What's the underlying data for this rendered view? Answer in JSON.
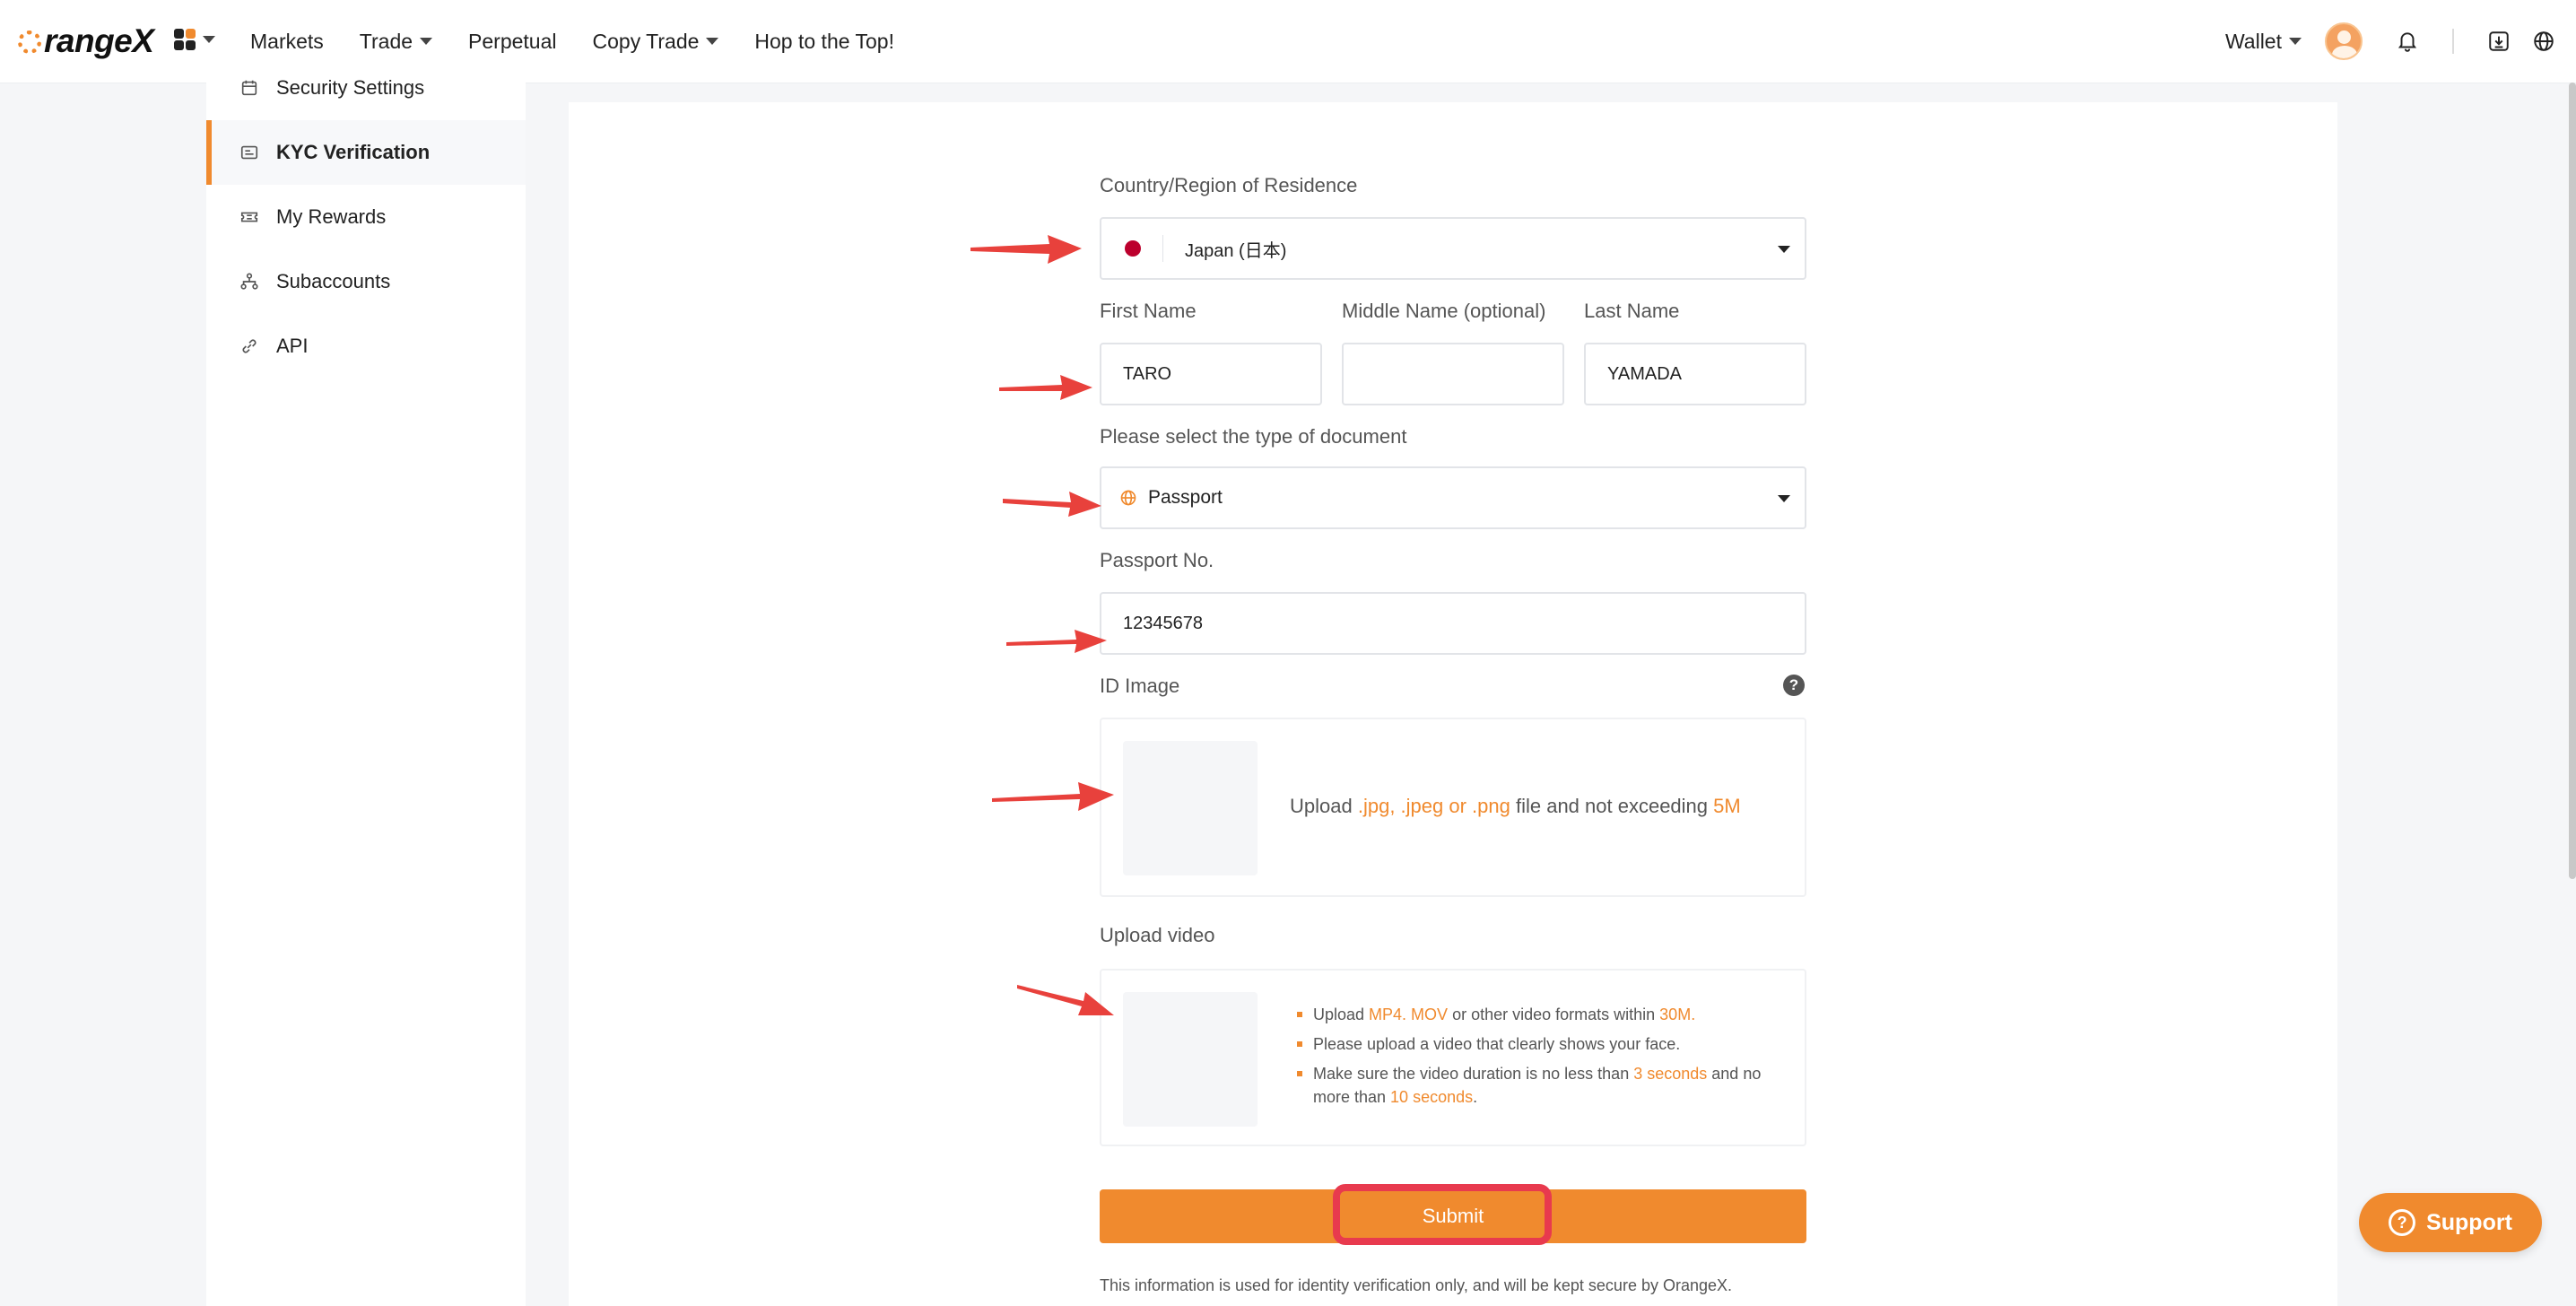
{
  "brand": {
    "name": "rangeX",
    "accent": "#f08a2e"
  },
  "nav": {
    "items": [
      "Markets",
      "Trade",
      "Perpetual",
      "Copy Trade",
      "Hop to the Top!"
    ],
    "wallet": "Wallet"
  },
  "sidebar": {
    "items": [
      {
        "label": "Security Settings",
        "icon": "calendar-icon"
      },
      {
        "label": "KYC Verification",
        "icon": "id-card-icon"
      },
      {
        "label": "My Rewards",
        "icon": "ticket-icon"
      },
      {
        "label": "Subaccounts",
        "icon": "org-chart-icon"
      },
      {
        "label": "API",
        "icon": "link-icon"
      }
    ]
  },
  "form": {
    "country_label": "Country/Region of Residence",
    "country_value": "Japan (日本)",
    "first_name_label": "First Name",
    "first_name_value": "TARO",
    "middle_name_label": "Middle Name (optional)",
    "middle_name_value": "",
    "last_name_label": "Last Name",
    "last_name_value": "YAMADA",
    "doc_type_label": "Please select the type of document",
    "doc_type_value": "Passport",
    "passport_label": "Passport No.",
    "passport_value": "12345678",
    "id_image_label": "ID Image",
    "id_image_help": "?",
    "id_upload": {
      "prefix": "Upload ",
      "formats": ".jpg, .jpeg or .png",
      "middle": " file and not exceeding ",
      "limit": "5M"
    },
    "video_label": "Upload video",
    "video_bullets": {
      "b1_prefix": "Upload ",
      "b1_formats": "MP4. MOV",
      "b1_middle": " or other video formats within ",
      "b1_limit": "30M.",
      "b2": "Please upload a video that clearly shows your face.",
      "b3_prefix": "Make sure the video duration is no less than ",
      "b3_min": "3 seconds",
      "b3_middle": " and no more than ",
      "b3_max": "10 seconds",
      "b3_suffix": "."
    },
    "submit_label": "Submit",
    "footnote": "This information is used for identity verification only, and will be kept secure by OrangeX."
  },
  "support": {
    "label": "Support",
    "icon": "question-icon"
  },
  "annotations": {
    "arrow_color": "#e8413c",
    "highlight_color": "#e83a4e"
  }
}
